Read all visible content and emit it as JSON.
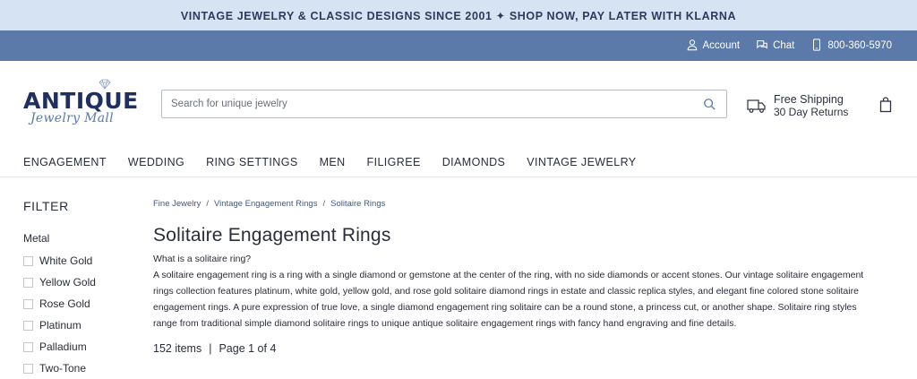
{
  "promo": {
    "text": "VINTAGE JEWELRY & CLASSIC DESIGNS SINCE 2001 ✦ SHOP NOW, PAY LATER WITH KLARNA"
  },
  "utility": {
    "account": "Account",
    "chat": "Chat",
    "phone": "800-360-5970"
  },
  "logo": {
    "main": "ANTIQUE",
    "sub": "Jewelry Mall"
  },
  "search": {
    "placeholder": "Search for unique jewelry",
    "value": ""
  },
  "shipping": {
    "title": "Free Shipping",
    "subtitle": "30 Day Returns"
  },
  "nav": {
    "items": [
      {
        "label": "ENGAGEMENT"
      },
      {
        "label": "WEDDING"
      },
      {
        "label": "RING SETTINGS"
      },
      {
        "label": "MEN"
      },
      {
        "label": "FILIGREE"
      },
      {
        "label": "DIAMONDS"
      },
      {
        "label": "VINTAGE JEWELRY"
      }
    ]
  },
  "sidebar": {
    "title": "FILTER",
    "metal_label": "Metal",
    "metals": [
      {
        "label": "White Gold"
      },
      {
        "label": "Yellow Gold"
      },
      {
        "label": "Rose Gold"
      },
      {
        "label": "Platinum"
      },
      {
        "label": "Palladium"
      },
      {
        "label": "Two-Tone"
      }
    ]
  },
  "breadcrumb": {
    "items": [
      "Fine Jewelry",
      "Vintage Engagement Rings",
      "Solitaire Rings"
    ],
    "separator": "/"
  },
  "main": {
    "title": "Solitaire Engagement Rings",
    "question": "What is a solitaire ring?",
    "description": "A solitaire engagement ring is a ring with a single diamond or gemstone at the center of the ring, with no side diamonds or accent stones. Our vintage solitaire engagement rings collection features platinum, white gold, yellow gold, and rose gold solitaire diamond rings in estate and classic replica styles, and elegant fine colored stone solitaire engagement rings. A pure expression of true love, a single diamond engagement ring solitaire can be a round stone, a princess cut, or another shape. Solitaire ring styles range from traditional simple diamond solitaire rings to unique antique solitaire engagement rings with fancy hand engraving and fine details.",
    "items_count": "152 items",
    "results_separator": "|",
    "page_info": "Page 1 of 4"
  },
  "colors": {
    "promo_bg": "#d6e3f3",
    "utility_bg": "#5b79a9",
    "brand_navy": "#1f2f62",
    "link": "#3a5a8c"
  },
  "icons": [
    "user-icon",
    "chat-icon",
    "phone-icon",
    "search-icon",
    "truck-icon",
    "shopping-bag-icon",
    "diamond-icon"
  ]
}
